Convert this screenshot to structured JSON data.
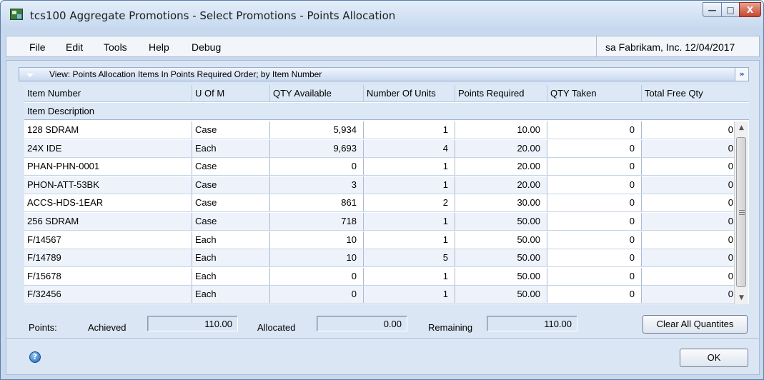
{
  "window": {
    "title": "tcs100 Aggregate Promotions - Select Promotions - Points Allocation",
    "minimize_glyph": "—",
    "maximize_glyph": "□",
    "close_glyph": "X"
  },
  "menu": {
    "items": [
      "File",
      "Edit",
      "Tools",
      "Help",
      "Debug"
    ],
    "company_info": "sa  Fabrikam, Inc. 12/04/2017"
  },
  "view": {
    "label": "View: Points Allocation Items In Points Required Order; by Item Number"
  },
  "grid": {
    "columns": [
      "Item Number",
      "U Of M",
      "QTY Available",
      "Number Of Units",
      "Points Required",
      "QTY Taken",
      "Total Free Qty"
    ],
    "second_header": "Item Description",
    "rows": [
      {
        "item": "128 SDRAM",
        "uom": "Case",
        "qty_available": "5,934",
        "units": "1",
        "points": "10.00",
        "qty_taken": "0",
        "free_qty": "0"
      },
      {
        "item": "24X IDE",
        "uom": "Each",
        "qty_available": "9,693",
        "units": "4",
        "points": "20.00",
        "qty_taken": "0",
        "free_qty": "0"
      },
      {
        "item": "PHAN-PHN-0001",
        "uom": "Case",
        "qty_available": "0",
        "units": "1",
        "points": "20.00",
        "qty_taken": "0",
        "free_qty": "0"
      },
      {
        "item": "PHON-ATT-53BK",
        "uom": "Case",
        "qty_available": "3",
        "units": "1",
        "points": "20.00",
        "qty_taken": "0",
        "free_qty": "0"
      },
      {
        "item": "ACCS-HDS-1EAR",
        "uom": "Case",
        "qty_available": "861",
        "units": "2",
        "points": "30.00",
        "qty_taken": "0",
        "free_qty": "0"
      },
      {
        "item": "256 SDRAM",
        "uom": "Case",
        "qty_available": "718",
        "units": "1",
        "points": "50.00",
        "qty_taken": "0",
        "free_qty": "0"
      },
      {
        "item": "F/14567",
        "uom": "Each",
        "qty_available": "10",
        "units": "1",
        "points": "50.00",
        "qty_taken": "0",
        "free_qty": "0"
      },
      {
        "item": "F/14789",
        "uom": "Each",
        "qty_available": "10",
        "units": "5",
        "points": "50.00",
        "qty_taken": "0",
        "free_qty": "0"
      },
      {
        "item": "F/15678",
        "uom": "Each",
        "qty_available": "0",
        "units": "1",
        "points": "50.00",
        "qty_taken": "0",
        "free_qty": "0"
      },
      {
        "item": "F/32456",
        "uom": "Each",
        "qty_available": "0",
        "units": "1",
        "points": "50.00",
        "qty_taken": "0",
        "free_qty": "0"
      }
    ]
  },
  "footer": {
    "points_label": "Points:",
    "achieved_label": "Achieved",
    "achieved_value": "110.00",
    "allocated_label": "Allocated",
    "allocated_value": "0.00",
    "remaining_label": "Remaining",
    "remaining_value": "110.00",
    "clear_button": "Clear All Quantites",
    "ok_button": "OK"
  }
}
